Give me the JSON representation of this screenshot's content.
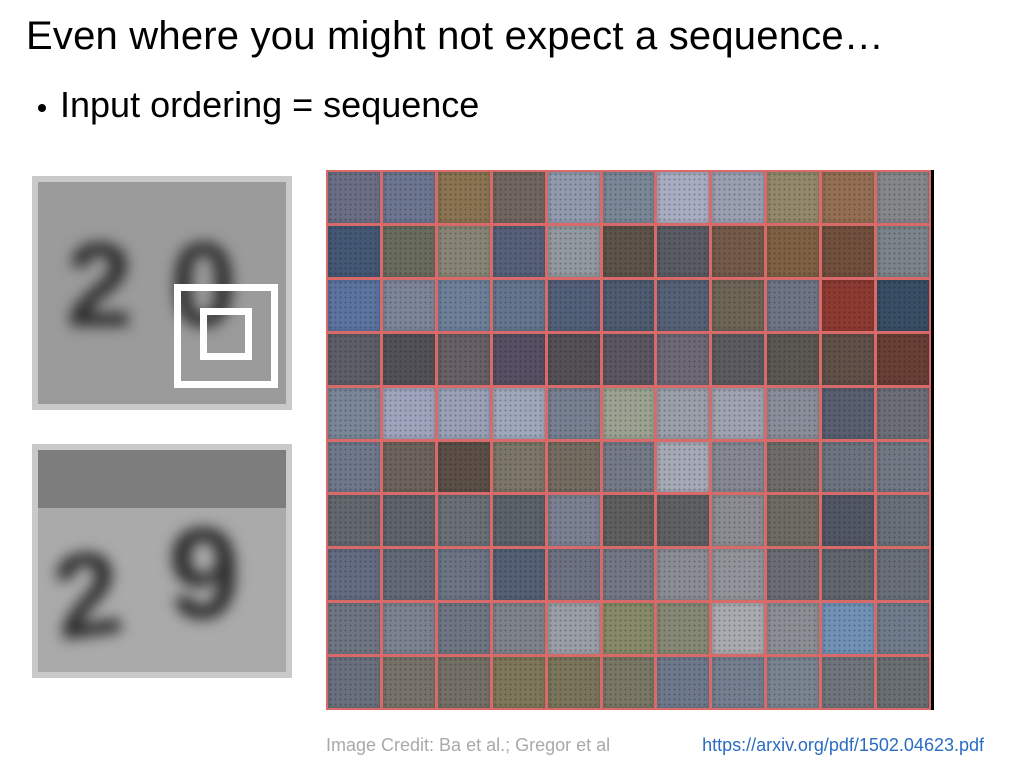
{
  "title": "Even where you might not expect a sequence…",
  "bullet": "Input ordering = sequence",
  "credit": "Image Credit: Ba et al.; Gregor et al",
  "link_text": "https://arxiv.org/pdf/1502.04623.pdf",
  "link_href": "https://arxiv.org/pdf/1502.04623.pdf",
  "grid": {
    "rows": 10,
    "cols": 11,
    "cells": [
      "#6b6f85",
      "#6c7690",
      "#8a7452",
      "#70665f",
      "#929aae",
      "#7a8796",
      "#a8adc2",
      "#9aa0b1",
      "#93896a",
      "#946f53",
      "#86878b",
      "#445875",
      "#6a6b5f",
      "#898576",
      "#566078",
      "#92999f",
      "#5e5349",
      "#5a5b64",
      "#745a4b",
      "#7f6144",
      "#734f3e",
      "#7b858a",
      "#5c74a0",
      "#7d8598",
      "#6e8099",
      "#64768e",
      "#536079",
      "#4f5b70",
      "#556176",
      "#6e6557",
      "#6e7584",
      "#8d3b32",
      "#394e64",
      "#5e5e68",
      "#515157",
      "#676064",
      "#555063",
      "#545056",
      "#5b5660",
      "#6e6876",
      "#5c5b60",
      "#595852",
      "#605048",
      "#6a3f36",
      "#7a8798",
      "#9fa4bd",
      "#9aa0b6",
      "#9fa7bb",
      "#778091",
      "#9ca292",
      "#9a9fab",
      "#a0a3b1",
      "#8a8e9a",
      "#595f70",
      "#6c6f77",
      "#70788c",
      "#6e635c",
      "#5b4f48",
      "#7c7768",
      "#756c61",
      "#757a87",
      "#a6aab6",
      "#858893",
      "#6f6d6a",
      "#6d7480",
      "#727884",
      "#63686e",
      "#5f636a",
      "#6a6f76",
      "#5b6269",
      "#7b8193",
      "#5f5f5f",
      "#5e6063",
      "#8c8d92",
      "#6e6c62",
      "#525764",
      "#687079",
      "#636c82",
      "#636a77",
      "#6c7485",
      "#536075",
      "#6d7283",
      "#737884",
      "#8a8d96",
      "#92949b",
      "#6a6d75",
      "#61656e",
      "#696f79",
      "#6f7683",
      "#7c8290",
      "#6f7683",
      "#7e828b",
      "#9a9ea7",
      "#878a68",
      "#878976",
      "#a9abb0",
      "#8b8e94",
      "#7192b6",
      "#6f7c8b",
      "#6a717e",
      "#77736a",
      "#757067",
      "#7e7759",
      "#7b755c",
      "#7a7766",
      "#6e7a8c",
      "#747f8f",
      "#7a8491",
      "#70757c",
      "#6a6f73"
    ]
  }
}
